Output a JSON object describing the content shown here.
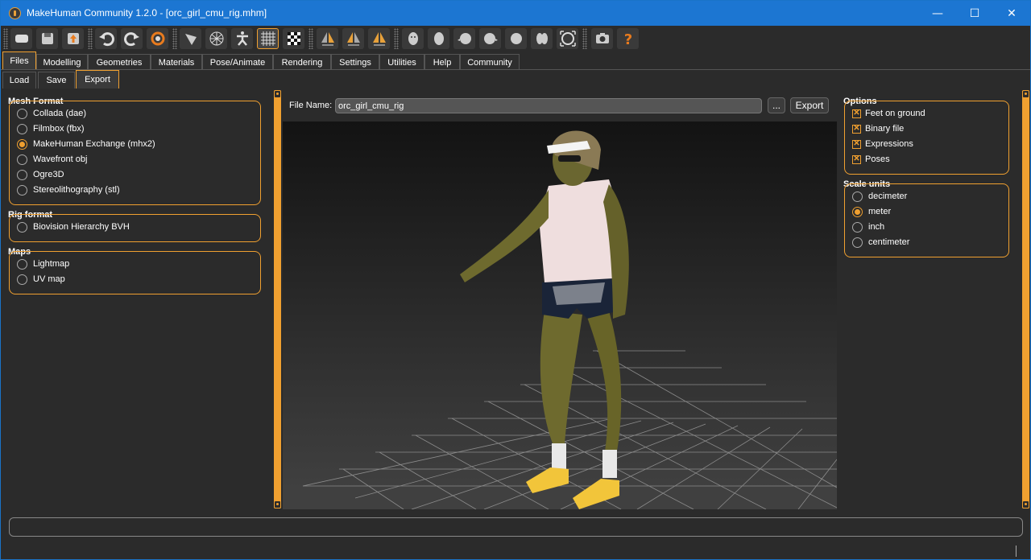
{
  "window": {
    "title": "MakeHuman Community 1.2.0 - [orc_girl_cmu_rig.mhm]",
    "minimize": "—",
    "maximize": "☐",
    "close": "✕"
  },
  "toolbar": {
    "icons": [
      "new-icon",
      "save-icon",
      "export-icon",
      "undo-icon",
      "redo-icon",
      "reset-icon",
      "smooth-icon",
      "wireframe-icon",
      "pose-icon",
      "grid-icon",
      "background-icon",
      "symmetry-right-icon",
      "symmetry-left-icon",
      "symmetry-icon",
      "front-view-icon",
      "back-view-icon",
      "left-view-icon",
      "right-view-icon",
      "top-view-icon",
      "bottom-view-icon",
      "reset-camera-icon",
      "screenshot-icon",
      "help-icon"
    ]
  },
  "tabs": [
    "Files",
    "Modelling",
    "Geometries",
    "Materials",
    "Pose/Animate",
    "Rendering",
    "Settings",
    "Utilities",
    "Help",
    "Community"
  ],
  "active_tab": "Files",
  "subtabs": [
    "Load",
    "Save",
    "Export"
  ],
  "active_subtab": "Export",
  "left": {
    "mesh_format": {
      "title": "Mesh Format",
      "options": [
        "Collada (dae)",
        "Filmbox (fbx)",
        "MakeHuman Exchange (mhx2)",
        "Wavefront obj",
        "Ogre3D",
        "Stereolithography (stl)"
      ],
      "selected": "MakeHuman Exchange (mhx2)"
    },
    "rig_format": {
      "title": "Rig format",
      "options": [
        "Biovision Hierarchy BVH"
      ]
    },
    "maps": {
      "title": "Maps",
      "options": [
        "Lightmap",
        "UV map"
      ]
    }
  },
  "center": {
    "file_name_label": "File Name:",
    "file_name_value": "orc_girl_cmu_rig",
    "browse_label": "...",
    "export_label": "Export"
  },
  "right": {
    "options": {
      "title": "Options",
      "items": [
        {
          "label": "Feet on ground",
          "checked": true
        },
        {
          "label": "Binary file",
          "checked": true
        },
        {
          "label": "Expressions",
          "checked": true
        },
        {
          "label": "Poses",
          "checked": true
        }
      ]
    },
    "scale_units": {
      "title": "Scale units",
      "options": [
        "decimeter",
        "meter",
        "inch",
        "centimeter"
      ],
      "selected": "meter"
    }
  },
  "colors": {
    "accent": "#f0a030",
    "titlebar": "#1c76d2",
    "background": "#2b2b2b"
  }
}
